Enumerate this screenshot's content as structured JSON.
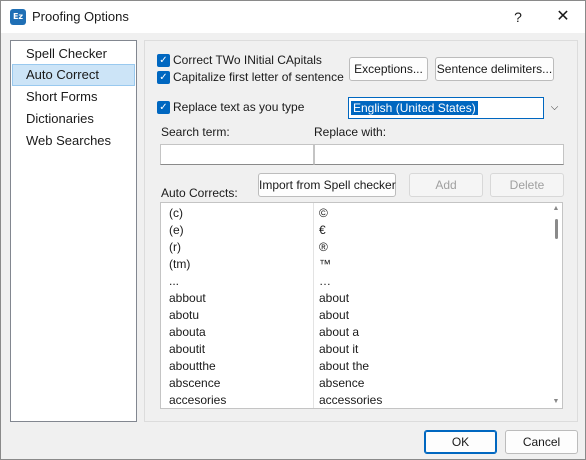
{
  "window": {
    "title": "Proofing Options",
    "app_icon_text": "Ez",
    "help_label": "?",
    "close_label": "✕"
  },
  "sidebar": {
    "items": [
      {
        "label": "Spell Checker"
      },
      {
        "label": "Auto Correct",
        "selected": true
      },
      {
        "label": "Short Forms"
      },
      {
        "label": "Dictionaries"
      },
      {
        "label": "Web Searches"
      }
    ]
  },
  "options": {
    "correct_two_initial": {
      "label": "Correct TWo INitial CApitals",
      "checked": true
    },
    "capitalize_first": {
      "label": "Capitalize first letter of sentence",
      "checked": true
    },
    "replace_as_type": {
      "label": "Replace text as you type",
      "checked": true
    },
    "exceptions_label": "Exceptions...",
    "sentence_delimiters_label": "Sentence delimiters...",
    "language_value": "English (United States)"
  },
  "search": {
    "search_term_label": "Search term:",
    "replace_with_label": "Replace with:",
    "search_value": "",
    "replace_value": ""
  },
  "autocorrects": {
    "label": "Auto Corrects:",
    "import_label": "Import from Spell checker",
    "add_label": "Add",
    "delete_label": "Delete",
    "rows": [
      [
        "(c)",
        "©"
      ],
      [
        "(e)",
        "€"
      ],
      [
        "(r)",
        "®"
      ],
      [
        "(tm)",
        "™"
      ],
      [
        "...",
        "…"
      ],
      [
        "abbout",
        "about"
      ],
      [
        "abotu",
        "about"
      ],
      [
        "abouta",
        "about a"
      ],
      [
        "aboutit",
        "about it"
      ],
      [
        "aboutthe",
        "about the"
      ],
      [
        "abscence",
        "absence"
      ],
      [
        "accesories",
        "accessories"
      ]
    ]
  },
  "footer": {
    "ok_label": "OK",
    "cancel_label": "Cancel"
  },
  "colors": {
    "accent": "#0067c0",
    "selection_bg": "#cce4f7"
  }
}
